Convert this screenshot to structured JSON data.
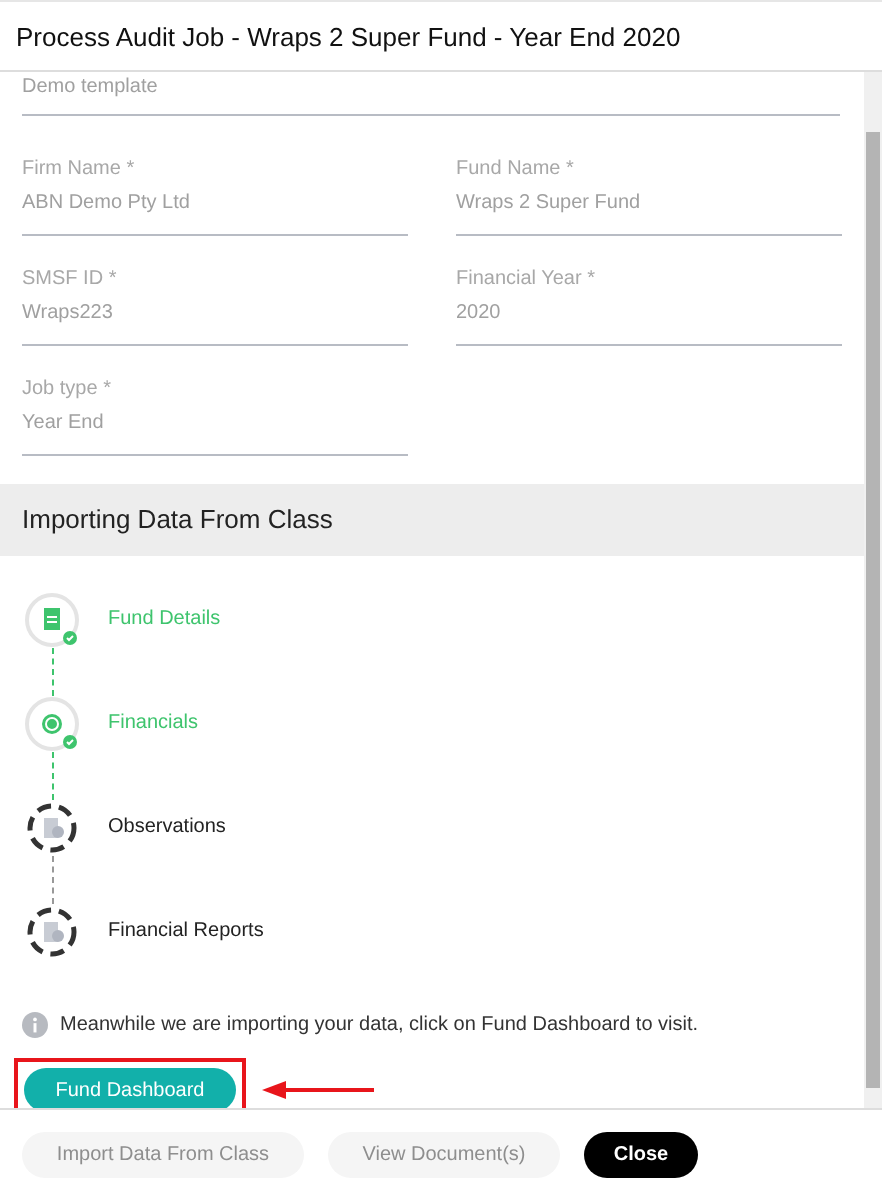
{
  "window": {
    "title": "Process Audit Job - Wraps 2 Super Fund - Year End 2020"
  },
  "template_field": {
    "value": "Demo template"
  },
  "fields": [
    {
      "label": "Firm Name *",
      "value": "ABN Demo Pty Ltd"
    },
    {
      "label": "Fund Name *",
      "value": "Wraps 2 Super Fund"
    },
    {
      "label": "SMSF ID *",
      "value": "Wraps223"
    },
    {
      "label": "Financial Year *",
      "value": "2020"
    },
    {
      "label": "Job type *",
      "value": "Year End"
    }
  ],
  "section": {
    "title": "Importing Data From Class"
  },
  "steps": [
    {
      "label": "Fund Details",
      "kind": "document",
      "done": true
    },
    {
      "label": "Financials",
      "kind": "coin",
      "done": true
    },
    {
      "label": "Observations",
      "kind": "report",
      "done": false
    },
    {
      "label": "Financial Reports",
      "kind": "report",
      "done": false
    }
  ],
  "info": "Meanwhile we are importing your data, click on Fund Dashboard to visit.",
  "dashboard_button": {
    "label": "Fund Dashboard",
    "highlighted": true
  },
  "footer_buttons": [
    {
      "label": "Import Data From Class",
      "disabled": true
    },
    {
      "label": "View Document(s)",
      "disabled": true
    },
    {
      "label": "Close",
      "disabled": false
    }
  ]
}
